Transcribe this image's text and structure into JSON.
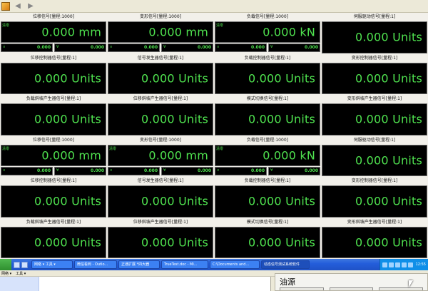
{
  "panels": [
    {
      "title": "位移信号[量程:1000]",
      "value": "0.000 mm",
      "tag": "清零",
      "sub1": "0.000",
      "sub2": "0.000",
      "sym1": "∩",
      "sym2": "∀"
    },
    {
      "title": "变形信号[量程:1000]",
      "value": "0.000 mm",
      "tag": "",
      "sub1": "0.000",
      "sub2": "0.000",
      "sym1": "∩",
      "sym2": "∀"
    },
    {
      "title": "负载信号[量程:1000]",
      "value": "0.000 kN",
      "tag": "清零",
      "sub1": "0.000",
      "sub2": "0.000",
      "sym1": "∩",
      "sym2": "∀"
    },
    {
      "title": "伺服驱动信号[量程:1]",
      "value": "0.000 Units"
    },
    {
      "title": "位移控制器信号[量程:1]",
      "value": "0.000 Units"
    },
    {
      "title": "信号发生器信号[量程:1]",
      "value": "0.000 Units"
    },
    {
      "title": "负载控制器信号[量程:1]",
      "value": "0.000 Units"
    },
    {
      "title": "变形控制器信号[量程:1]",
      "value": "0.000 Units"
    },
    {
      "title": "负载斜坡产生器信号[量程:1]",
      "value": "0.000 Units"
    },
    {
      "title": "位移斜坡产生器信号[量程:1]",
      "value": "0.000 Units"
    },
    {
      "title": "模式切换信号[量程:1]",
      "value": "0.000 Units"
    },
    {
      "title": "变形斜坡产生器信号[量程:1]",
      "value": "0.000 Units"
    },
    {
      "title": "位移信号[量程:1000]",
      "value": "0.000 mm",
      "tag": "清零",
      "sub1": "0.000",
      "sub2": "0.000",
      "sym1": "∩",
      "sym2": "∀"
    },
    {
      "title": "变形信号[量程:1000]",
      "value": "0.000 mm",
      "tag": "清零",
      "sub1": "0.000",
      "sub2": "0.000",
      "sym1": "∩",
      "sym2": "∀"
    },
    {
      "title": "负载信号[量程:1000]",
      "value": "0.000 kN",
      "tag": "清零",
      "sub1": "0.000",
      "sub2": "0.000",
      "sym1": "∩",
      "sym2": "∀"
    },
    {
      "title": "伺服驱动信号[量程:1]",
      "value": "0.000 Units"
    },
    {
      "title": "位移控制器信号[量程:1]",
      "value": "0.000 Units"
    },
    {
      "title": "信号发生器信号[量程:1]",
      "value": "0.000 Units"
    },
    {
      "title": "负载控制器信号[量程:1]",
      "value": "0.000 Units"
    },
    {
      "title": "变形控制器信号[量程:1]",
      "value": "0.000 Units"
    },
    {
      "title": "负载斜坡产生器信号[量程:1]",
      "value": "0.000 Units"
    },
    {
      "title": "位移斜坡产生器信号[量程:1]",
      "value": "0.000 Units"
    },
    {
      "title": "模式切换信号[量程:1]",
      "value": "0.000 Units"
    },
    {
      "title": "变形斜坡产生器信号[量程:1]",
      "value": "0.000 Units"
    }
  ],
  "taskbar": {
    "buttons": [
      {
        "label": "网络 ▾  工具 ▾",
        "active": false
      },
      {
        "label": "微信看到 - Outlo...",
        "active": false
      },
      {
        "label": "正通扩展 *四大器",
        "active": false
      },
      {
        "label": "TrueTest.doc - Mi...",
        "active": false
      },
      {
        "label": "C:\\Documents and...",
        "active": false
      },
      {
        "label": "动态信号测试系统软件",
        "active": true
      }
    ],
    "clock": "12:55"
  },
  "explorer": {
    "menu": [
      "网络 ▾",
      "工具 ▾"
    ]
  },
  "dialog": {
    "title": "油源"
  }
}
